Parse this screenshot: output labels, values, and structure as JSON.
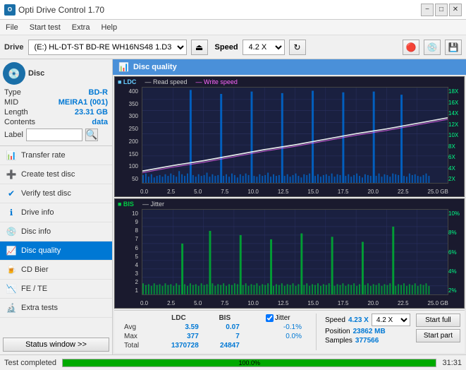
{
  "titleBar": {
    "title": "Opti Drive Control 1.70",
    "minimizeLabel": "−",
    "maximizeLabel": "□",
    "closeLabel": "✕"
  },
  "menuBar": {
    "items": [
      "File",
      "Start test",
      "Extra",
      "Help"
    ]
  },
  "toolbar": {
    "driveLabel": "Drive",
    "driveValue": "(E:)  HL-DT-ST BD-RE  WH16NS48 1.D3",
    "speedLabel": "Speed",
    "speedValue": "4.2 X"
  },
  "sidebar": {
    "disc": {
      "typeLabel": "Type",
      "typeValue": "BD-R",
      "midLabel": "MID",
      "midValue": "MEIRA1 (001)",
      "lengthLabel": "Length",
      "lengthValue": "23.31 GB",
      "contentsLabel": "Contents",
      "contentsValue": "data",
      "labelLabel": "Label"
    },
    "navItems": [
      {
        "id": "transfer-rate",
        "label": "Transfer rate"
      },
      {
        "id": "create-test-disc",
        "label": "Create test disc"
      },
      {
        "id": "verify-test-disc",
        "label": "Verify test disc"
      },
      {
        "id": "drive-info",
        "label": "Drive info"
      },
      {
        "id": "disc-info",
        "label": "Disc info"
      },
      {
        "id": "disc-quality",
        "label": "Disc quality",
        "active": true
      },
      {
        "id": "cd-bier",
        "label": "CD Bier"
      },
      {
        "id": "fe-te",
        "label": "FE / TE"
      },
      {
        "id": "extra-tests",
        "label": "Extra tests"
      }
    ],
    "statusBtn": "Status window >>"
  },
  "qualityPanel": {
    "title": "Disc quality"
  },
  "chart1": {
    "title": "LDC",
    "legendItems": [
      {
        "label": "LDC",
        "color": "#00aaff"
      },
      {
        "label": "Read speed",
        "color": "#ffffff"
      },
      {
        "label": "Write speed",
        "color": "#ff00ff"
      }
    ],
    "yLabels": [
      "400",
      "350",
      "300",
      "250",
      "200",
      "150",
      "100",
      "50"
    ],
    "yLabelsRight": [
      "18X",
      "16X",
      "14X",
      "12X",
      "10X",
      "8X",
      "6X",
      "4X",
      "2X"
    ],
    "xLabels": [
      "0.0",
      "2.5",
      "5.0",
      "7.5",
      "10.0",
      "12.5",
      "15.0",
      "17.5",
      "20.0",
      "22.5",
      "25.0 GB"
    ]
  },
  "chart2": {
    "title": "BIS",
    "legendItems": [
      {
        "label": "BIS",
        "color": "#00cc44"
      },
      {
        "label": "Jitter",
        "color": "#ffffff"
      }
    ],
    "yLabels": [
      "10",
      "9",
      "8",
      "7",
      "6",
      "5",
      "4",
      "3",
      "2",
      "1"
    ],
    "yLabelsRight": [
      "10%",
      "8%",
      "6%",
      "4%",
      "2%"
    ],
    "xLabels": [
      "0.0",
      "2.5",
      "5.0",
      "7.5",
      "10.0",
      "12.5",
      "15.0",
      "17.5",
      "20.0",
      "22.5",
      "25.0 GB"
    ]
  },
  "stats": {
    "headers": [
      "LDC",
      "BIS",
      "",
      "Jitter",
      "Speed",
      ""
    ],
    "avgLabel": "Avg",
    "avgLDC": "3.59",
    "avgBIS": "0.07",
    "avgJitter": "-0.1%",
    "maxLabel": "Max",
    "maxLDC": "377",
    "maxBIS": "7",
    "maxJitter": "0.0%",
    "totalLabel": "Total",
    "totalLDC": "1370728",
    "totalBIS": "24847",
    "speedLabel": "Speed",
    "speedValue": "4.23 X",
    "speedDropdown": "4.2 X",
    "positionLabel": "Position",
    "positionValue": "23862 MB",
    "samplesLabel": "Samples",
    "samplesValue": "377566",
    "startFullBtn": "Start full",
    "startPartBtn": "Start part",
    "jitterChecked": true,
    "jitterLabel": "Jitter"
  },
  "statusBar": {
    "text": "Test completed",
    "progressPercent": 100,
    "progressText": "100.0%",
    "time": "31:31"
  }
}
